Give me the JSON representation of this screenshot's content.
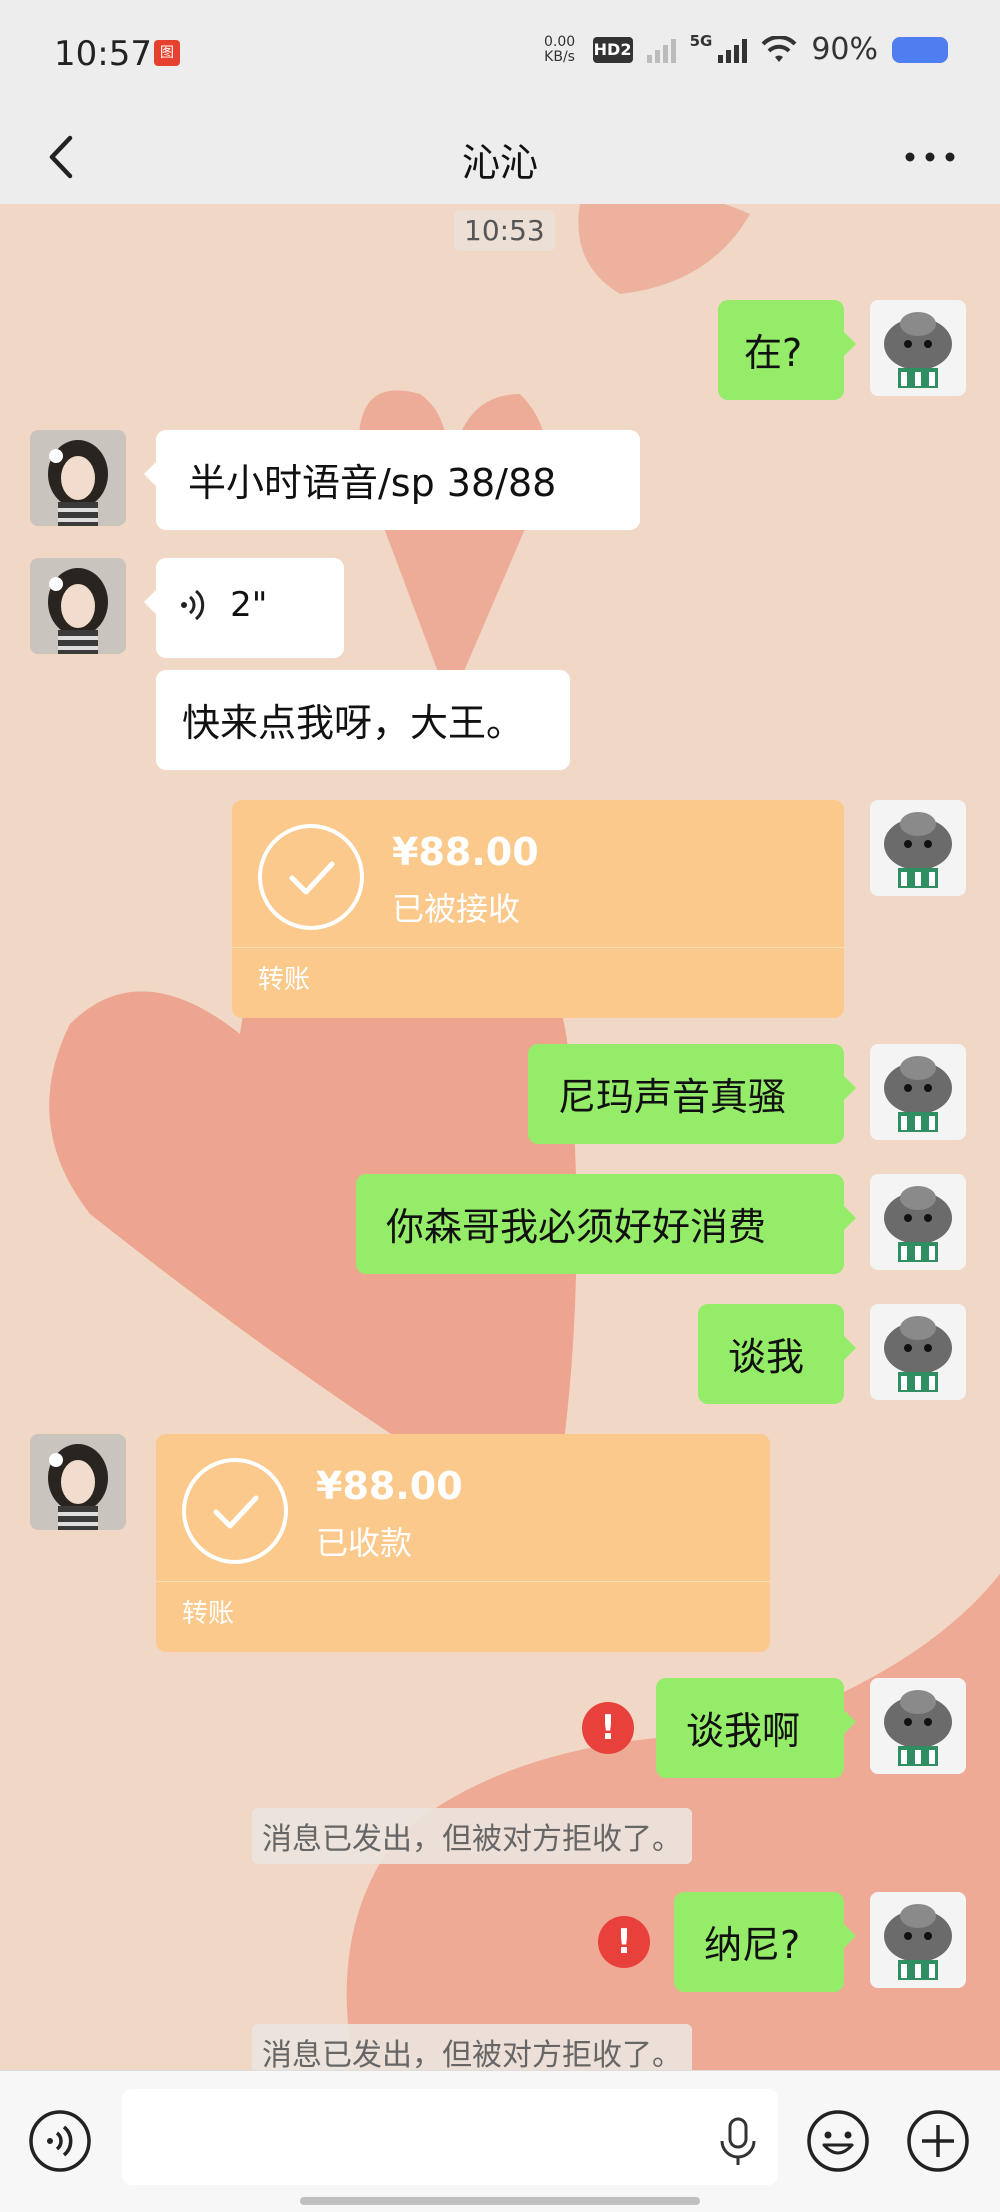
{
  "status_bar": {
    "time": "10:57",
    "net_speed": "0.00",
    "net_unit": "KB/s",
    "hd_label": "HD2",
    "network": "5G",
    "battery": "90%"
  },
  "header": {
    "title": "沁沁"
  },
  "messages": {
    "timestamp": "10:53",
    "m1": "在?",
    "m2": "半小时语音/sp  38/88",
    "m3_voice_duration": "2\"",
    "m4": "快来点我呀，大王。",
    "transfer1": {
      "amount": "¥88.00",
      "status": "已被接收",
      "label": "转账"
    },
    "m5": "尼玛声音真骚",
    "m6": "你森哥我必须好好消费",
    "m7": "谈我",
    "transfer2": {
      "amount": "¥88.00",
      "status": "已收款",
      "label": "转账"
    },
    "m8": "谈我啊",
    "notice1": "消息已发出，但被对方拒收了。",
    "m9": "纳尼?",
    "notice2": "消息已发出，但被对方拒收了。",
    "error_mark": "!"
  },
  "input_bar": {
    "placeholder": ""
  },
  "colors": {
    "outgoing_bubble": "#95ec69",
    "incoming_bubble": "#ffffff",
    "transfer_card": "#fbc98b",
    "error": "#e8413c"
  },
  "icons": [
    "back-arrow-icon",
    "more-icon",
    "voice-icon",
    "microphone-icon",
    "emoji-icon",
    "plus-icon",
    "error-icon",
    "check-icon"
  ]
}
